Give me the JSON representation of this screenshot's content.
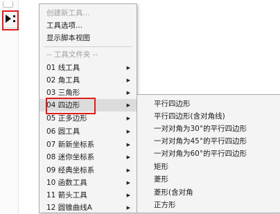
{
  "menu": {
    "header_items": [
      {
        "label": "创建新工具...",
        "disabled": true
      },
      {
        "label": "工具选项...",
        "disabled": false
      },
      {
        "label": "显示脚本视图",
        "disabled": false
      }
    ],
    "folder_section_label": "-- 工具文件夹 --",
    "folders": [
      {
        "label": "01 线工具",
        "has_submenu": true
      },
      {
        "label": "02 角工具",
        "has_submenu": true
      },
      {
        "label": "03 三角形",
        "has_submenu": true
      },
      {
        "label": "04 四边形",
        "has_submenu": true,
        "selected": true
      },
      {
        "label": "05 正多边形",
        "has_submenu": true
      },
      {
        "label": "06 圆工具",
        "has_submenu": true
      },
      {
        "label": "07 新新坐标系",
        "has_submenu": true
      },
      {
        "label": "08 迷你坐标系",
        "has_submenu": true
      },
      {
        "label": "09 经典坐标系",
        "has_submenu": true
      },
      {
        "label": "10 函数工具",
        "has_submenu": true
      },
      {
        "label": "11 箭头工具",
        "has_submenu": true
      },
      {
        "label": "12 圆锥曲线A",
        "has_submenu": true
      }
    ]
  },
  "submenu": {
    "items": [
      "平行四边形",
      "平行四边形(含对角线)",
      "一对对角为30°的平行四边形",
      "一对对角为45°的平行四边形",
      "一对对角为60°的平行四边形",
      "矩形",
      "菱形",
      "菱形(含对角",
      "正方形"
    ]
  },
  "colors": {
    "highlight_box": "#e21a1a",
    "menu_bg": "#f4f4f4",
    "selected_bg": "#dcdcdc"
  }
}
